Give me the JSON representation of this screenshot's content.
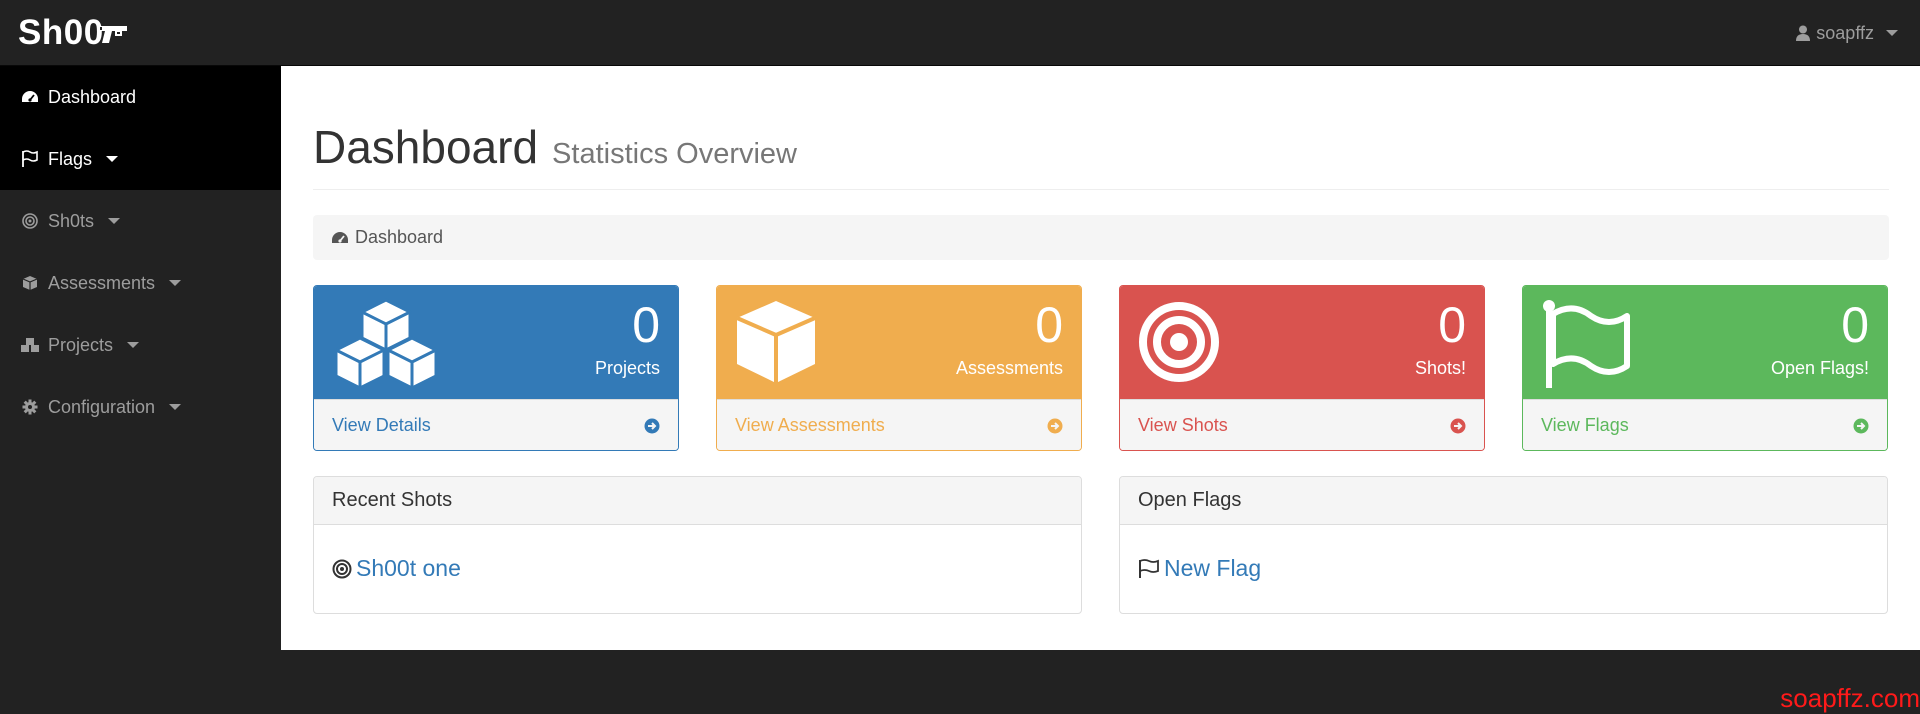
{
  "brand": {
    "name": "Sh00"
  },
  "user_menu": {
    "username": "soapffz"
  },
  "sidebar": {
    "items": [
      {
        "label": "Dashboard",
        "icon": "dashboard-icon",
        "has_caret": false
      },
      {
        "label": "Flags",
        "icon": "flag-icon",
        "has_caret": true
      },
      {
        "label": "Sh0ts",
        "icon": "target-icon",
        "has_caret": true
      },
      {
        "label": "Assessments",
        "icon": "cube-icon",
        "has_caret": true
      },
      {
        "label": "Projects",
        "icon": "cubes-icon",
        "has_caret": true
      },
      {
        "label": "Configuration",
        "icon": "gear-icon",
        "has_caret": true
      }
    ]
  },
  "page": {
    "title": "Dashboard",
    "subtitle": "Statistics Overview"
  },
  "breadcrumb": {
    "label": "Dashboard",
    "icon": "dashboard-icon"
  },
  "stats": [
    {
      "count": "0",
      "label": "Projects",
      "link": "View Details",
      "color": "#337ab7",
      "icon": "cubes-icon"
    },
    {
      "count": "0",
      "label": "Assessments",
      "link": "View Assessments",
      "color": "#f0ad4e",
      "icon": "cube-icon"
    },
    {
      "count": "0",
      "label": "Shots!",
      "link": "View Shots",
      "color": "#d9534f",
      "icon": "target-icon"
    },
    {
      "count": "0",
      "label": "Open Flags!",
      "link": "View Flags",
      "color": "#5cb85c",
      "icon": "flag-icon"
    }
  ],
  "recent_shots": {
    "heading": "Recent Shots",
    "items": [
      {
        "label": "Sh00t one",
        "icon": "target-icon"
      }
    ]
  },
  "open_flags": {
    "heading": "Open Flags",
    "items": [
      {
        "label": "New Flag",
        "icon": "flag-icon"
      }
    ]
  },
  "watermark": {
    "text": "soapffz.com"
  }
}
